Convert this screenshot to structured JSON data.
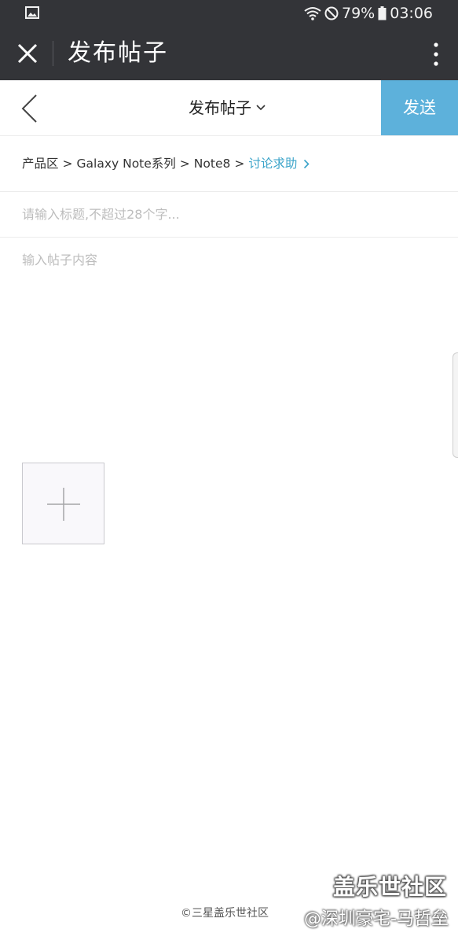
{
  "status_bar": {
    "battery_percent": "79%",
    "time": "03:06",
    "icons": [
      "gallery-icon",
      "wifi-icon",
      "do-not-disturb-icon",
      "battery-icon"
    ]
  },
  "app_bar": {
    "title": "发布帖子",
    "icons": [
      "close-icon",
      "more-vertical-icon"
    ]
  },
  "nav": {
    "title": "发布帖子",
    "send_label": "发送",
    "icons": [
      "back-chevron-icon",
      "chevron-down-icon"
    ]
  },
  "breadcrumb": {
    "items": [
      "产品区",
      "Galaxy Note系列",
      "Note8"
    ],
    "separator": ">",
    "current": "讨论求助"
  },
  "form": {
    "title_placeholder": "请输入标题,不超过28个字...",
    "content_placeholder": "输入帖子内容"
  },
  "watermark": {
    "brand": "盖乐世社区",
    "copyright": "©三星盖乐世社区",
    "author": "@深圳豪宅-马哲垒"
  },
  "colors": {
    "header_bg": "#333438",
    "accent": "#5db1db",
    "link": "#3aa3c9"
  }
}
